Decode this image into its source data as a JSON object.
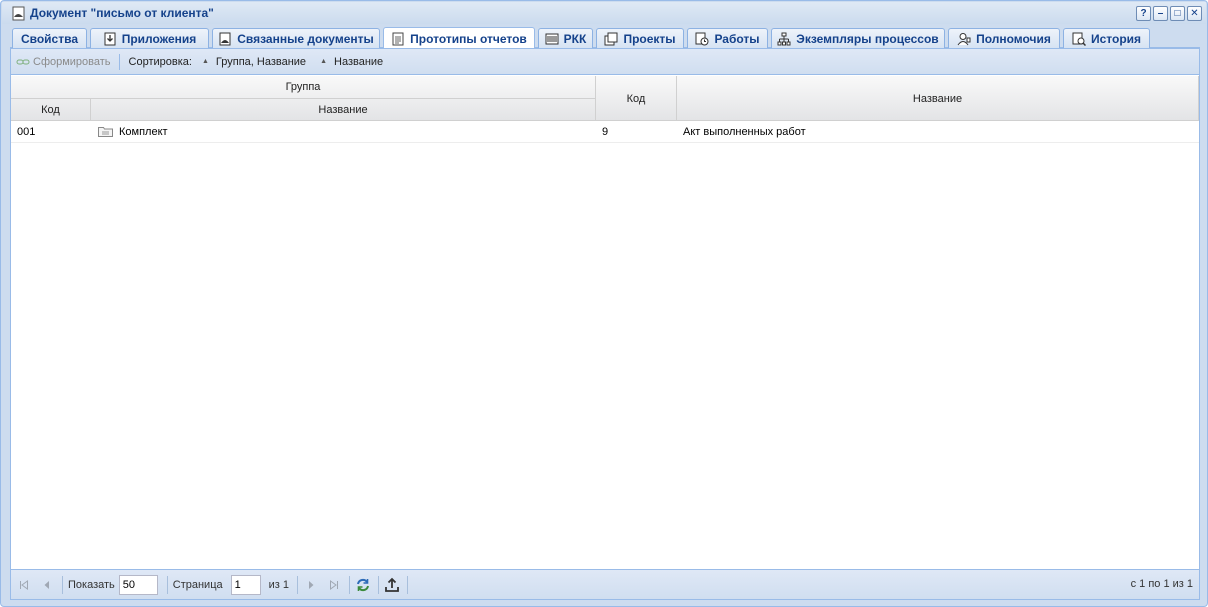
{
  "window": {
    "title": "Документ \"письмо от клиента\"",
    "tools": [
      "?",
      "–",
      "□",
      "✕"
    ]
  },
  "tabs": [
    {
      "label": "Свойства",
      "icon": "",
      "active": false
    },
    {
      "label": "Приложения",
      "icon": "attachment-icon",
      "active": false
    },
    {
      "label": "Связанные документы",
      "icon": "linked-docs-icon",
      "active": false
    },
    {
      "label": "Прототипы отчетов",
      "icon": "report-icon",
      "active": true
    },
    {
      "label": "РКК",
      "icon": "rkk-icon",
      "active": false
    },
    {
      "label": "Проекты",
      "icon": "projects-icon",
      "active": false
    },
    {
      "label": "Работы",
      "icon": "works-icon",
      "active": false
    },
    {
      "label": "Экземпляры процессов",
      "icon": "process-icon",
      "active": false
    },
    {
      "label": "Полномочия",
      "icon": "authority-icon",
      "active": false
    },
    {
      "label": "История",
      "icon": "history-icon",
      "active": false
    }
  ],
  "toolbar": {
    "generate_label": "Сформировать",
    "sort_label": "Сортировка:",
    "sort_items": [
      "Группа, Название",
      "Название"
    ]
  },
  "grid": {
    "group_header": "Группа",
    "group_code_header": "Код",
    "group_name_header": "Название",
    "code_header": "Код",
    "name_header": "Название",
    "rows": [
      {
        "group_code": "001",
        "group_name": "Комплект",
        "code": "9",
        "name": "Акт выполненных работ"
      }
    ]
  },
  "pager": {
    "show_label": "Показать",
    "page_size": "50",
    "page_label": "Страница",
    "page_value": "1",
    "of_label": "из 1",
    "status": "с 1 по 1 из 1"
  },
  "colors": {
    "header_text": "#15428b",
    "border": "#99bbe8",
    "panel_bg": "#cddcef"
  }
}
